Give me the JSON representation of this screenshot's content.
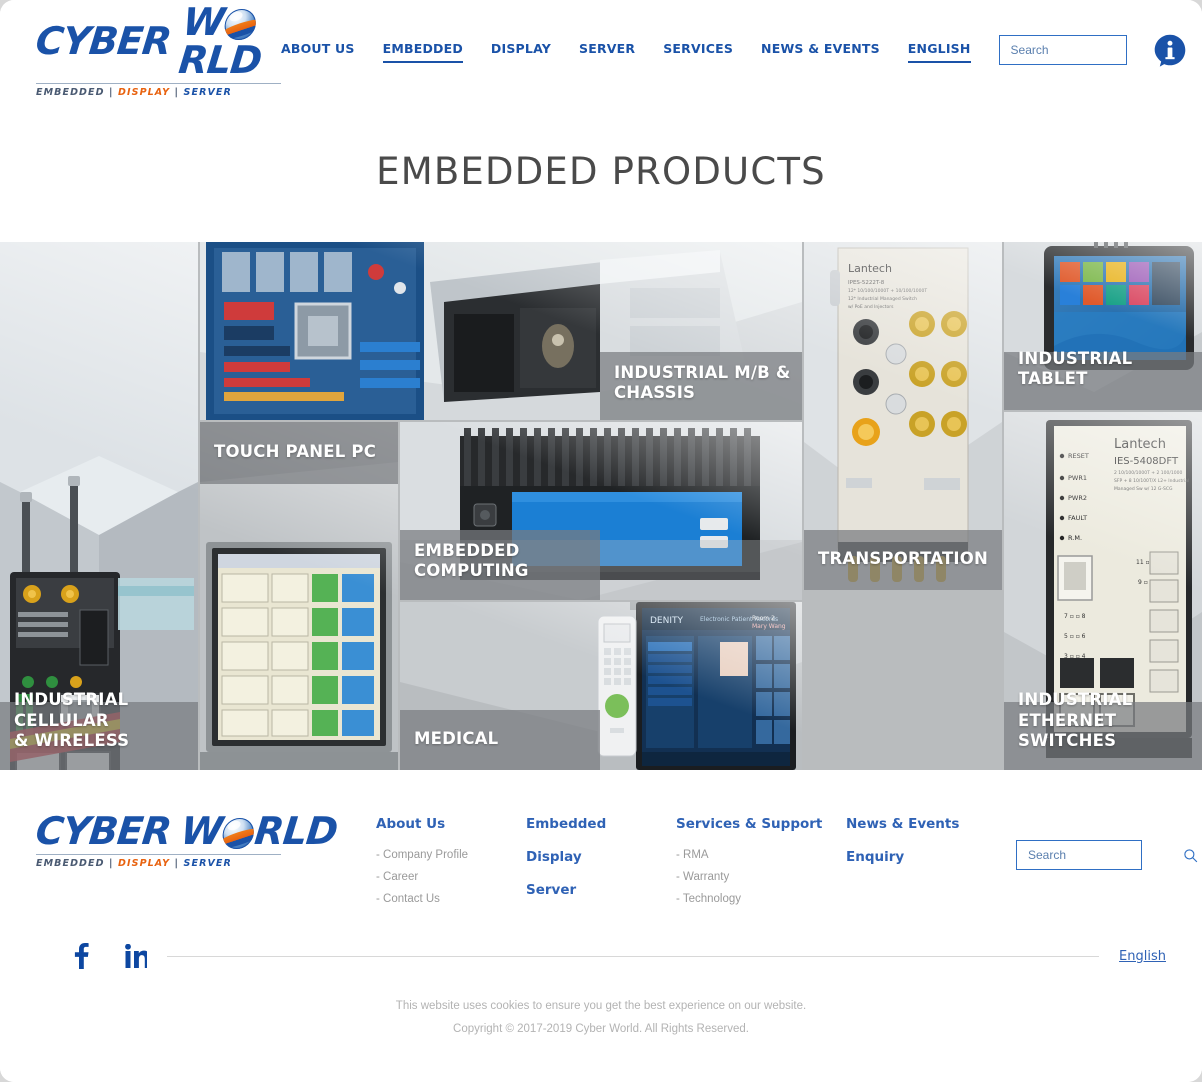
{
  "header": {
    "logo": {
      "word1": "CYBER",
      "word2": "W",
      "word2b": "RLD",
      "tagline_1": "EMBEDDED",
      "tagline_sep": " | ",
      "tagline_2": "DISPLAY",
      "tagline_3": "SERVER"
    },
    "nav": [
      {
        "label": "ABOUT US",
        "active": false
      },
      {
        "label": "EMBEDDED",
        "active": true
      },
      {
        "label": "DISPLAY",
        "active": false
      },
      {
        "label": "SERVER",
        "active": false
      },
      {
        "label": "SERVICES",
        "active": false
      },
      {
        "label": "NEWS & EVENTS",
        "active": false
      },
      {
        "label": "ENGLISH",
        "active": true
      }
    ],
    "search": {
      "placeholder": "Search",
      "value": ""
    },
    "info_icon": "info-icon"
  },
  "main": {
    "page_title": "EMBEDDED PRODUCTS",
    "tiles": [
      {
        "id": "t-cell",
        "label": "INDUSTRIAL CELLULAR\n& WIRELESS"
      },
      {
        "id": "t-mb",
        "label": "INDUSTRIAL M/B &\nCHASSIS"
      },
      {
        "id": "t-touch",
        "label": "TOUCH PANEL PC"
      },
      {
        "id": "t-emb",
        "label": "EMBEDDED\nCOMPUTING"
      },
      {
        "id": "t-med",
        "label": "MEDICAL"
      },
      {
        "id": "t-trans",
        "label": "TRANSPORTATION"
      },
      {
        "id": "t-tab",
        "label": "INDUSTRIAL TABLET"
      },
      {
        "id": "t-eth",
        "label": "INDUSTRIAL ETHERNET\nSWITCHES"
      }
    ]
  },
  "footer": {
    "columns": [
      {
        "heading": "About Us",
        "links": [
          "- Company Profile",
          "- Career",
          "- Contact Us"
        ]
      },
      {
        "heading": "Embedded",
        "sub_headings": [
          "Display",
          "Server"
        ],
        "links": []
      },
      {
        "heading": "Services & Support",
        "links": [
          "- RMA",
          "- Warranty",
          "- Technology"
        ]
      },
      {
        "heading": "News & Events",
        "sub_headings": [
          "Enquiry"
        ],
        "links": []
      }
    ],
    "search": {
      "placeholder": "Search",
      "value": ""
    },
    "social": [
      "facebook-icon",
      "linkedin-icon"
    ],
    "language_link": "English",
    "cookie_notice": "This website uses cookies to ensure you get the best experience on our website.",
    "copyright": "Copyright © 2017-2019 Cyber World. All Rights Reserved."
  },
  "colors": {
    "brand_blue": "#1a52a8",
    "link_blue": "#2f62b5",
    "accent_orange": "#e8620f",
    "tile_overlay": "#787c7f"
  }
}
